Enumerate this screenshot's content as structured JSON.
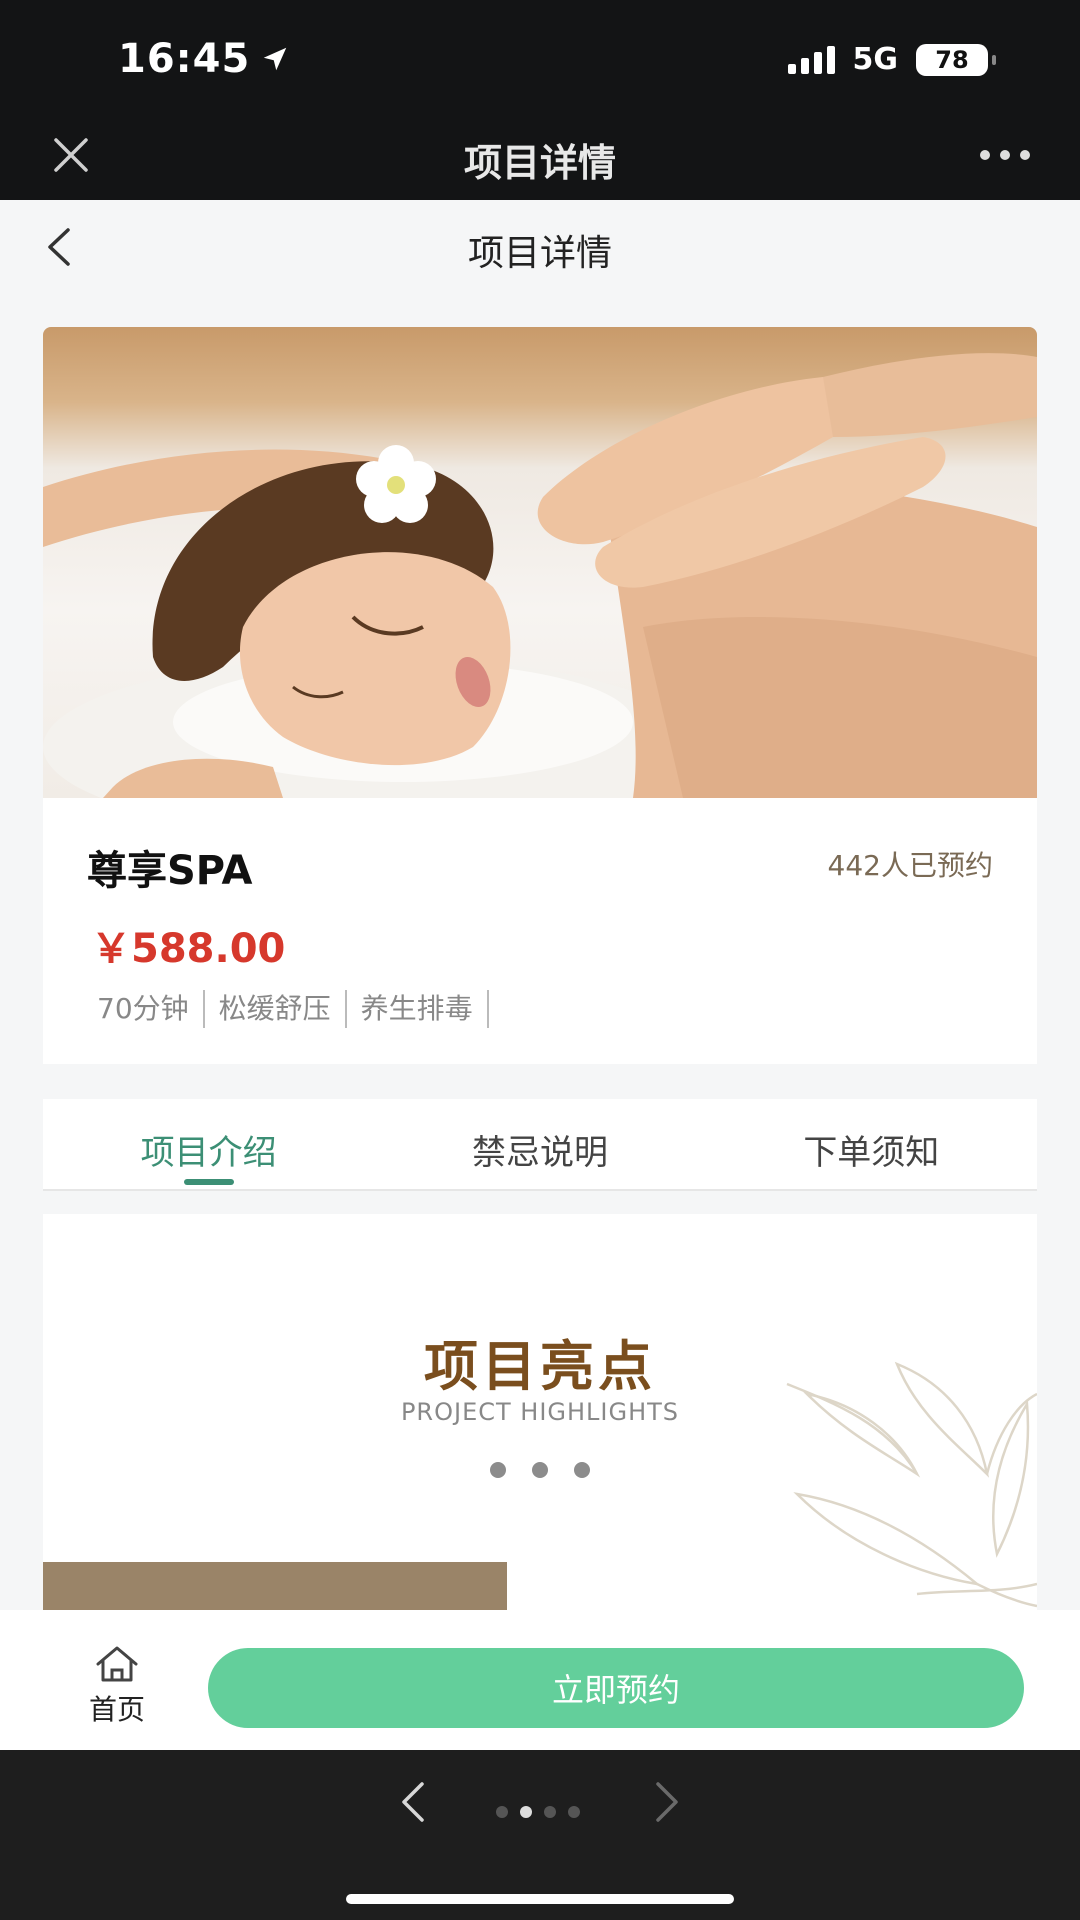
{
  "status_bar": {
    "time": "16:45",
    "network": "5G",
    "battery": "78"
  },
  "wechat_bar": {
    "title": "项目详情"
  },
  "page_header": {
    "title": "项目详情"
  },
  "project": {
    "name": "尊享SPA",
    "booked_count": "442人已预约",
    "price": "￥588.00",
    "tags": [
      "70分钟",
      "松缓舒压",
      "养生排毒"
    ]
  },
  "tabs": [
    {
      "label": "项目介绍",
      "active": true
    },
    {
      "label": "禁忌说明",
      "active": false
    },
    {
      "label": "下单须知",
      "active": false
    }
  ],
  "highlights": {
    "title": "项目亮点",
    "subtitle": "PROJECT HIGHLIGHTS"
  },
  "bottom_bar": {
    "home_label": "首页",
    "book_label": "立即预约"
  },
  "browser_nav": {
    "page_count": 4,
    "current_page": 2
  },
  "colors": {
    "accent_green": "#3c8f75",
    "book_button": "#63cf9b",
    "price_red": "#d6382c"
  },
  "icons": {
    "close": "close-icon",
    "more": "more-dots-icon",
    "back": "chevron-left-icon",
    "home": "home-icon",
    "location": "location-arrow-icon"
  }
}
